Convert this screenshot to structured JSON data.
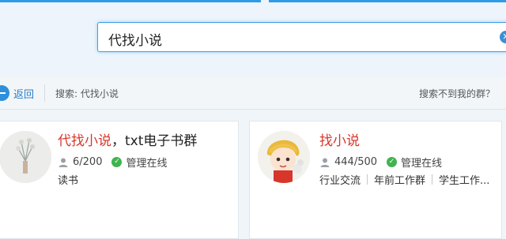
{
  "search": {
    "query": "代找小说"
  },
  "toolbar": {
    "back_label": "返回",
    "search_summary": "搜索: 代找小说",
    "not_found_link": "搜索不到我的群？"
  },
  "results": [
    {
      "name_highlight": "代找小说",
      "name_rest": "，txt电子书群",
      "members": "6/200",
      "status": "管理在线",
      "tags": [
        "读书"
      ]
    },
    {
      "name_highlight": "找小说",
      "name_rest": "",
      "members": "444/500",
      "status": "管理在线",
      "tags": [
        "行业交流",
        "年前工作群",
        "学生工作..."
      ]
    }
  ],
  "colors": {
    "accent": "#2d9be6",
    "highlight": "#d9362b",
    "online": "#40b34f"
  },
  "icons": [
    "back-icon",
    "clear-icon",
    "person-icon",
    "check-icon"
  ]
}
